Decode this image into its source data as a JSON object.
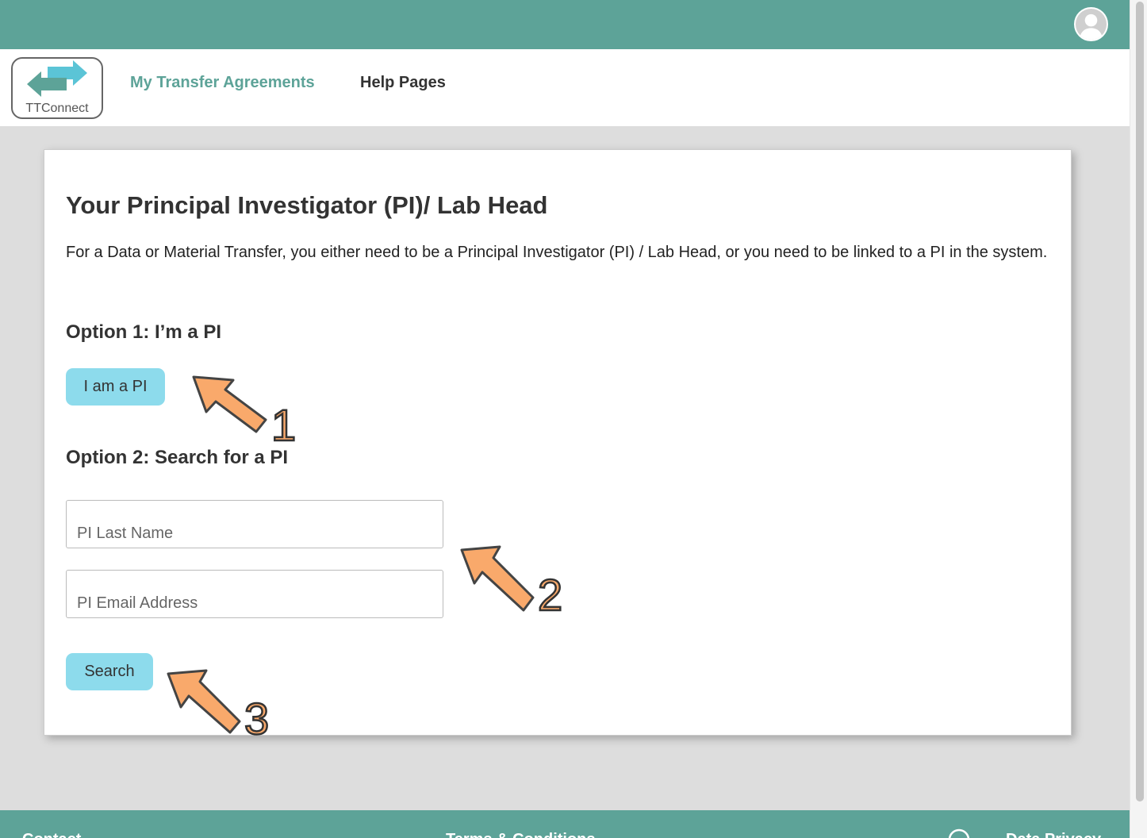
{
  "header": {
    "avatar_icon": "user-avatar-icon",
    "brand_color": "#5da398"
  },
  "nav": {
    "logo_text": "TTConnect",
    "links": [
      {
        "label": "My Transfer Agreements",
        "active": true
      },
      {
        "label": "Help Pages",
        "active": false
      }
    ]
  },
  "card": {
    "title": "Your Principal Investigator (PI)/ Lab Head",
    "description": "For a Data or Material Transfer, you either need to be a Principal Investigator (PI) / Lab Head, or you need to be linked to a PI in the system.",
    "option1": {
      "heading": "Option 1: I’m a PI",
      "button_label": "I am a PI"
    },
    "option2": {
      "heading": "Option 2: Search for a PI",
      "last_name_placeholder": "PI Last Name",
      "email_placeholder": "PI Email Address",
      "search_label": "Search"
    }
  },
  "annotations": {
    "step1": "1",
    "step2": "2",
    "step3": "3",
    "arrow_color": "#f9a96b"
  },
  "footer": {
    "contact": "Contact",
    "terms": "Terms & Conditions",
    "privacy": "Data Privacy"
  }
}
